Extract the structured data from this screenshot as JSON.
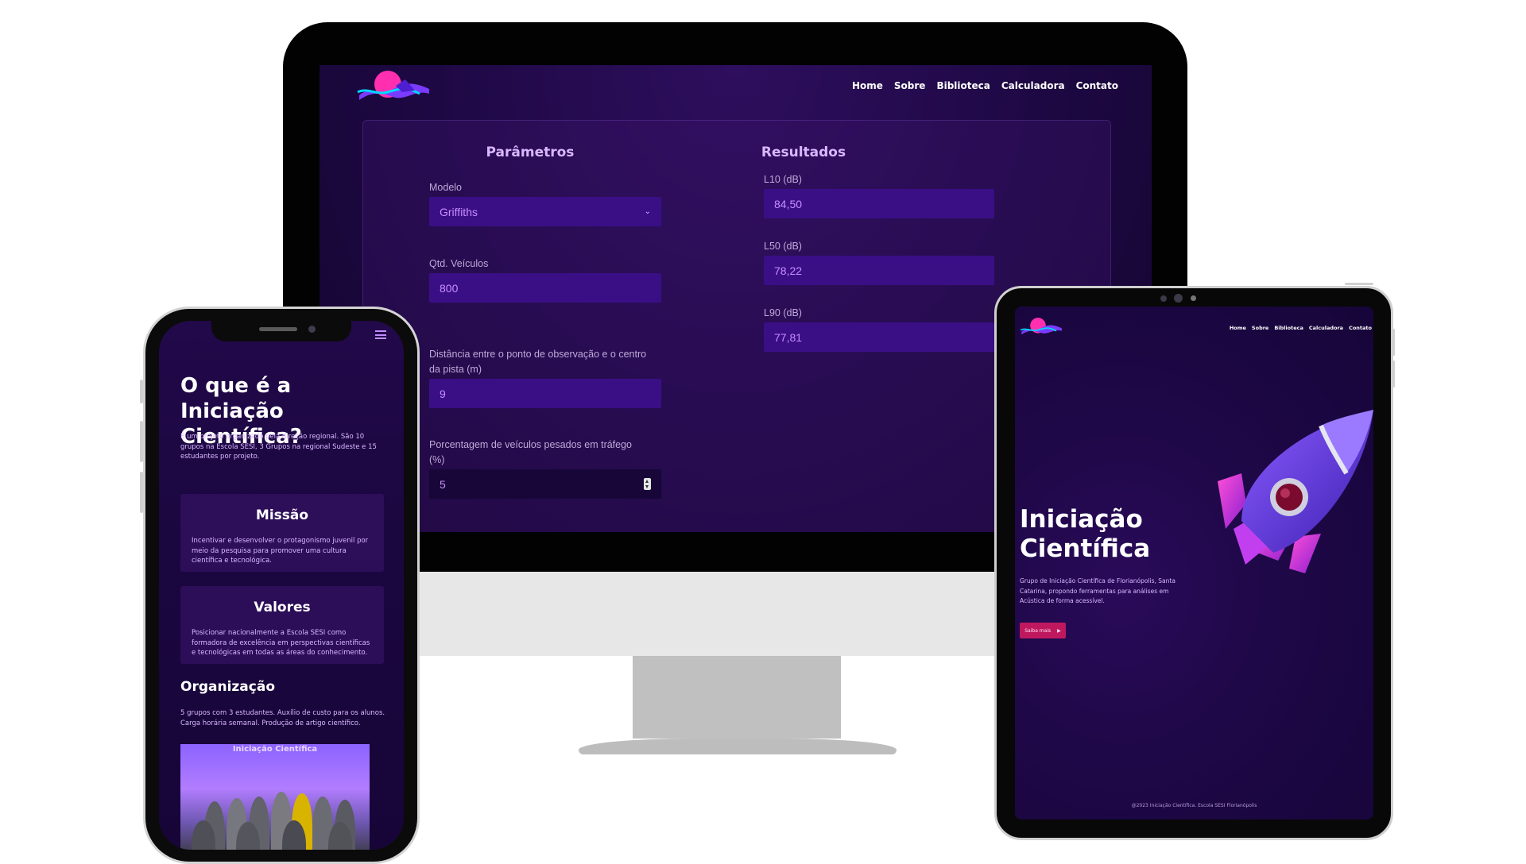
{
  "nav": [
    "Home",
    "Sobre",
    "Biblioteca",
    "Calculadora",
    "Contato"
  ],
  "calculator": {
    "params_title": "Parâmetros",
    "results_title": "Resultados",
    "fields": [
      {
        "label": "Modelo",
        "value": "Griffiths"
      },
      {
        "label": "Qtd. Veículos",
        "value": "800"
      },
      {
        "label": "Distância entre o ponto de observação e o centro da pista (m)",
        "value": "9"
      },
      {
        "label": "Porcentagem de veículos pesados em tráfego (%)",
        "value": "5"
      }
    ],
    "results": [
      {
        "label": "L10 (dB)",
        "value": "84,50"
      },
      {
        "label": "L50 (dB)",
        "value": "78,22"
      },
      {
        "label": "L90 (dB)",
        "value": "77,81"
      }
    ]
  },
  "phone": {
    "title": "O que é a Iniciação Científica?",
    "intro": "É um projeto organizado pela direção regional. São 10 grupos na Escola SESI, 3 Grupos na regional Sudeste e 15 estudantes por projeto.",
    "cards": [
      {
        "title": "Missão",
        "text": "Incentivar e desenvolver o protagonismo juvenil por meio da pesquisa para promover uma cultura científica e tecnológica."
      },
      {
        "title": "Valores",
        "text": "Posicionar nacionalmente a Escola SESI como formadora de excelência em perspectivas científicas e tecnológicas em todas as áreas do conhecimento."
      }
    ],
    "org_title": "Organização",
    "org_text": "5 grupos com 3 estudantes. Auxílio de custo para os alunos. Carga horária semanal. Produção de artigo científico.",
    "photo_caption": "Iniciação Científica"
  },
  "tablet": {
    "hero_title": "Iniciação Científica",
    "hero_text": "Grupo de Iniciação Científica de Florianópolis, Santa Catarina, propondo ferramentas para análises em Acústica de forma acessível.",
    "cta": "Saiba mais",
    "footer": "@2023 Iniciação Científica. Escola SESI Florianópolis"
  },
  "colors": {
    "accent_purple": "#3a0f86",
    "field_text": "#c98dff",
    "title_lilac": "#d9b8ff",
    "cta_magenta": "#c0185f"
  }
}
